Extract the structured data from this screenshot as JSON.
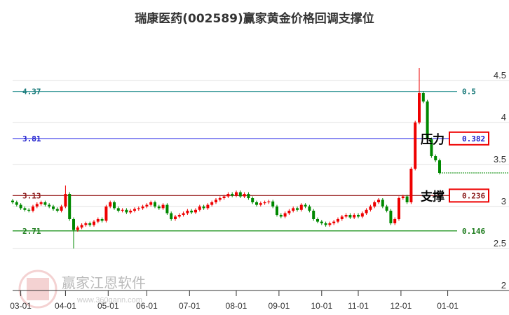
{
  "title": "瑞康医药(002589)赢家黄金价格回调支撑位",
  "watermark": {
    "brand": "赢家江恩软件",
    "url": "www.360gann.com",
    "seal": "江赢恩家"
  },
  "chart_data": {
    "type": "candlestick",
    "title": "瑞康医药(002589)赢家黄金价格回调支撑位",
    "ylim": [
      2,
      4.75
    ],
    "y_ticks": [
      {
        "value": 4.5,
        "label": "4.5"
      },
      {
        "value": 4,
        "label": "4"
      },
      {
        "value": 3.5,
        "label": "3.5"
      },
      {
        "value": 3,
        "label": "3"
      },
      {
        "value": 2.5,
        "label": "2.5"
      },
      {
        "value": 2,
        "label": "2"
      }
    ],
    "x_ticks": [
      "03-01",
      "04-01",
      "05-01",
      "06-01",
      "07-01",
      "08-01",
      "09-01",
      "10-01",
      "11-01",
      "12-01",
      "01-01"
    ],
    "x_tick_positions_index": [
      2,
      13,
      23.5,
      33,
      43.5,
      55,
      65.5,
      76,
      85,
      95.5,
      107
    ],
    "closes": [
      3.05,
      3.02,
      2.98,
      2.96,
      2.95,
      3.0,
      3.03,
      3.05,
      3.02,
      3.0,
      2.97,
      2.95,
      3.0,
      3.15,
      2.85,
      2.72,
      2.75,
      2.78,
      2.8,
      2.78,
      2.82,
      2.85,
      2.83,
      3.0,
      3.05,
      2.98,
      2.95,
      2.96,
      2.93,
      2.95,
      2.97,
      2.98,
      3.0,
      3.02,
      3.05,
      3.0,
      2.98,
      3.02,
      2.92,
      2.85,
      2.88,
      2.9,
      2.92,
      2.95,
      2.93,
      2.96,
      3.0,
      2.98,
      3.02,
      3.05,
      3.08,
      3.1,
      3.12,
      3.15,
      3.13,
      3.17,
      3.12,
      3.15,
      3.1,
      3.05,
      3.02,
      3.04,
      3.05,
      3.06,
      3.0,
      2.9,
      2.88,
      2.92,
      2.95,
      2.98,
      2.96,
      3.02,
      3.0,
      2.95,
      2.85,
      2.82,
      2.8,
      2.78,
      2.8,
      2.82,
      2.85,
      2.88,
      2.9,
      2.87,
      2.9,
      2.88,
      2.92,
      2.96,
      3.0,
      3.05,
      3.08,
      3.0,
      2.95,
      2.8,
      2.85,
      3.1,
      3.12,
      3.05,
      3.45,
      4.0,
      4.35,
      4.25,
      3.8,
      3.6,
      3.55,
      3.4
    ],
    "wick_extremes": [
      {
        "index": 13,
        "high": 3.25
      },
      {
        "index": 15,
        "low": 2.5
      },
      {
        "index": 100,
        "high": 4.65
      }
    ],
    "last_price": 3.4,
    "levels": [
      {
        "price": 4.37,
        "price_label": "4.37",
        "ratio": "0.5",
        "color": "#3a9a9a",
        "boxed": false
      },
      {
        "price": 3.81,
        "price_label": "3.81",
        "ratio": "0.382",
        "color": "#6666ee",
        "boxed": true,
        "tag": "压力"
      },
      {
        "price": 3.13,
        "price_label": "3.13",
        "ratio": "0.236",
        "color": "#a03030",
        "boxed": true,
        "tag": "支撑"
      },
      {
        "price": 2.71,
        "price_label": "2.71",
        "ratio": "0.146",
        "color": "#2a9a2a",
        "boxed": false
      }
    ],
    "label_colors": {
      "4.37": "#1a7a7a",
      "3.81": "#1a1acc",
      "3.13": "#8a1a1a",
      "2.71": "#1a7a1a"
    },
    "up_color": "#ee0000",
    "down_color": "#008800"
  }
}
